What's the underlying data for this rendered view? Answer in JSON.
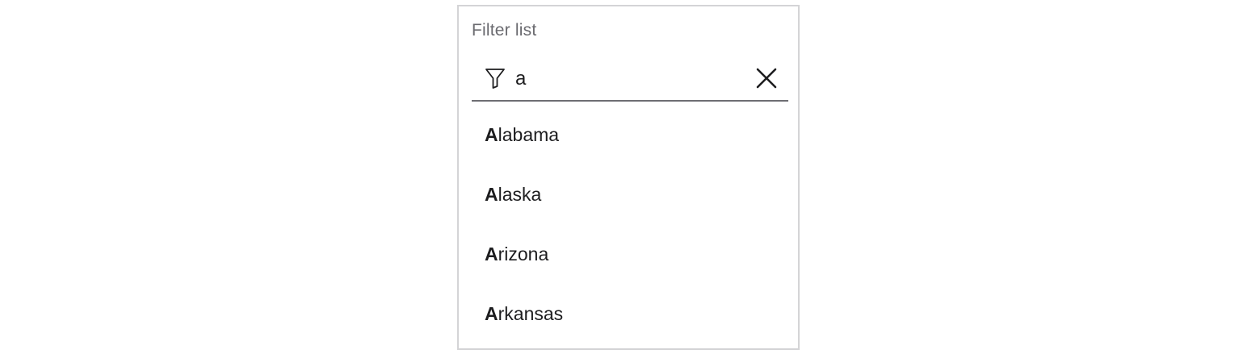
{
  "filter": {
    "label": "Filter list",
    "value": "a",
    "placeholder": "",
    "icon": "filter-icon",
    "clear_icon": "close-icon"
  },
  "results": [
    {
      "match": "A",
      "rest": "labama"
    },
    {
      "match": "A",
      "rest": "laska"
    },
    {
      "match": "A",
      "rest": "rizona"
    },
    {
      "match": "A",
      "rest": "rkansas"
    }
  ],
  "colors": {
    "border": "#d4d4d6",
    "label": "#6b6b70",
    "underline": "#6e6e73",
    "text": "#1d1d1f"
  }
}
